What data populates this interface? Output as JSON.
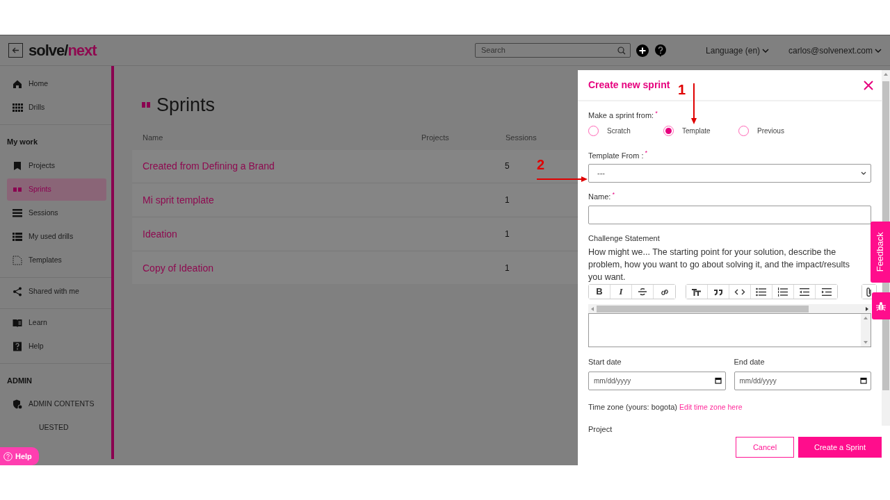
{
  "header": {
    "logo_left": "solve/",
    "logo_right": "next",
    "search": {
      "placeholder": "Search"
    },
    "language": "Language (en)",
    "user": "carlos@solvenext.com"
  },
  "sidebar": {
    "groups": [
      {
        "items": [
          {
            "label": "Home",
            "selected": false
          },
          {
            "label": "Drills",
            "selected": false
          }
        ]
      },
      {
        "heading": "My work",
        "items": [
          {
            "label": "Projects",
            "selected": false
          },
          {
            "label": "Sprints",
            "selected": true
          },
          {
            "label": "Sessions",
            "selected": false
          },
          {
            "label": "My used drills",
            "selected": false
          },
          {
            "label": "Templates",
            "selected": false
          }
        ]
      },
      {
        "items": [
          {
            "label": "Shared with me",
            "selected": false
          }
        ]
      },
      {
        "items": [
          {
            "label": "Learn",
            "selected": false
          },
          {
            "label": "Help",
            "selected": false
          }
        ]
      },
      {
        "heading": "ADMIN",
        "items": [
          {
            "label": "ADMIN CONTENTS",
            "selected": false
          },
          {
            "label": "UESTED",
            "selected": false
          }
        ]
      }
    ]
  },
  "page": {
    "title": "Sprints",
    "table": {
      "columns": [
        "Name",
        "Projects",
        "Sessions"
      ],
      "rows": [
        {
          "name": "Created from Defining a Brand",
          "sessions": "5"
        },
        {
          "name": "Mi sprit template",
          "sessions": "1"
        },
        {
          "name": "Ideation",
          "sessions": "1"
        },
        {
          "name": "Copy of Ideation",
          "sessions": "1"
        }
      ]
    }
  },
  "dialog": {
    "title": "Create new sprint",
    "source": {
      "label": "Make a sprint from:",
      "marker": "*",
      "options": [
        {
          "label": "Scratch",
          "selected": false
        },
        {
          "label": "Template",
          "selected": true
        },
        {
          "label": "Previous",
          "selected": false
        }
      ]
    },
    "template_from": {
      "label": "Template From :",
      "marker": "*",
      "value": "---"
    },
    "name": {
      "label": "Name:",
      "marker": "*"
    },
    "challenge": {
      "label": "Challenge Statement",
      "hint": "How might we... The starting point for your solution, describe the problem, how you want to go about solving it, and the impact/results you want.",
      "toolbar": [
        {
          "kind": "bold",
          "glyph": "B"
        },
        {
          "kind": "italic",
          "glyph": "I"
        },
        {
          "kind": "strike"
        },
        {
          "kind": "link"
        },
        {
          "kind": "heading"
        },
        {
          "kind": "quote"
        },
        {
          "kind": "code"
        },
        {
          "kind": "bullets"
        },
        {
          "kind": "numbers"
        },
        {
          "kind": "outdent"
        },
        {
          "kind": "indent"
        },
        {
          "kind": "attach"
        }
      ]
    },
    "start_date": {
      "label": "Start date",
      "placeholder": "mm/dd/yyyy"
    },
    "end_date": {
      "label": "End date",
      "placeholder": "mm/dd/yyyy"
    },
    "time_zone": {
      "text": "Time zone (yours: bogota)",
      "link": "Edit time zone here"
    },
    "project": {
      "label": "Project"
    },
    "cancel": "Cancel",
    "submit": "Create a Sprint"
  },
  "feedback_tab": "Feedback",
  "help_button": "Help",
  "annotations": [
    {
      "label": "1"
    },
    {
      "label": "2"
    }
  ]
}
